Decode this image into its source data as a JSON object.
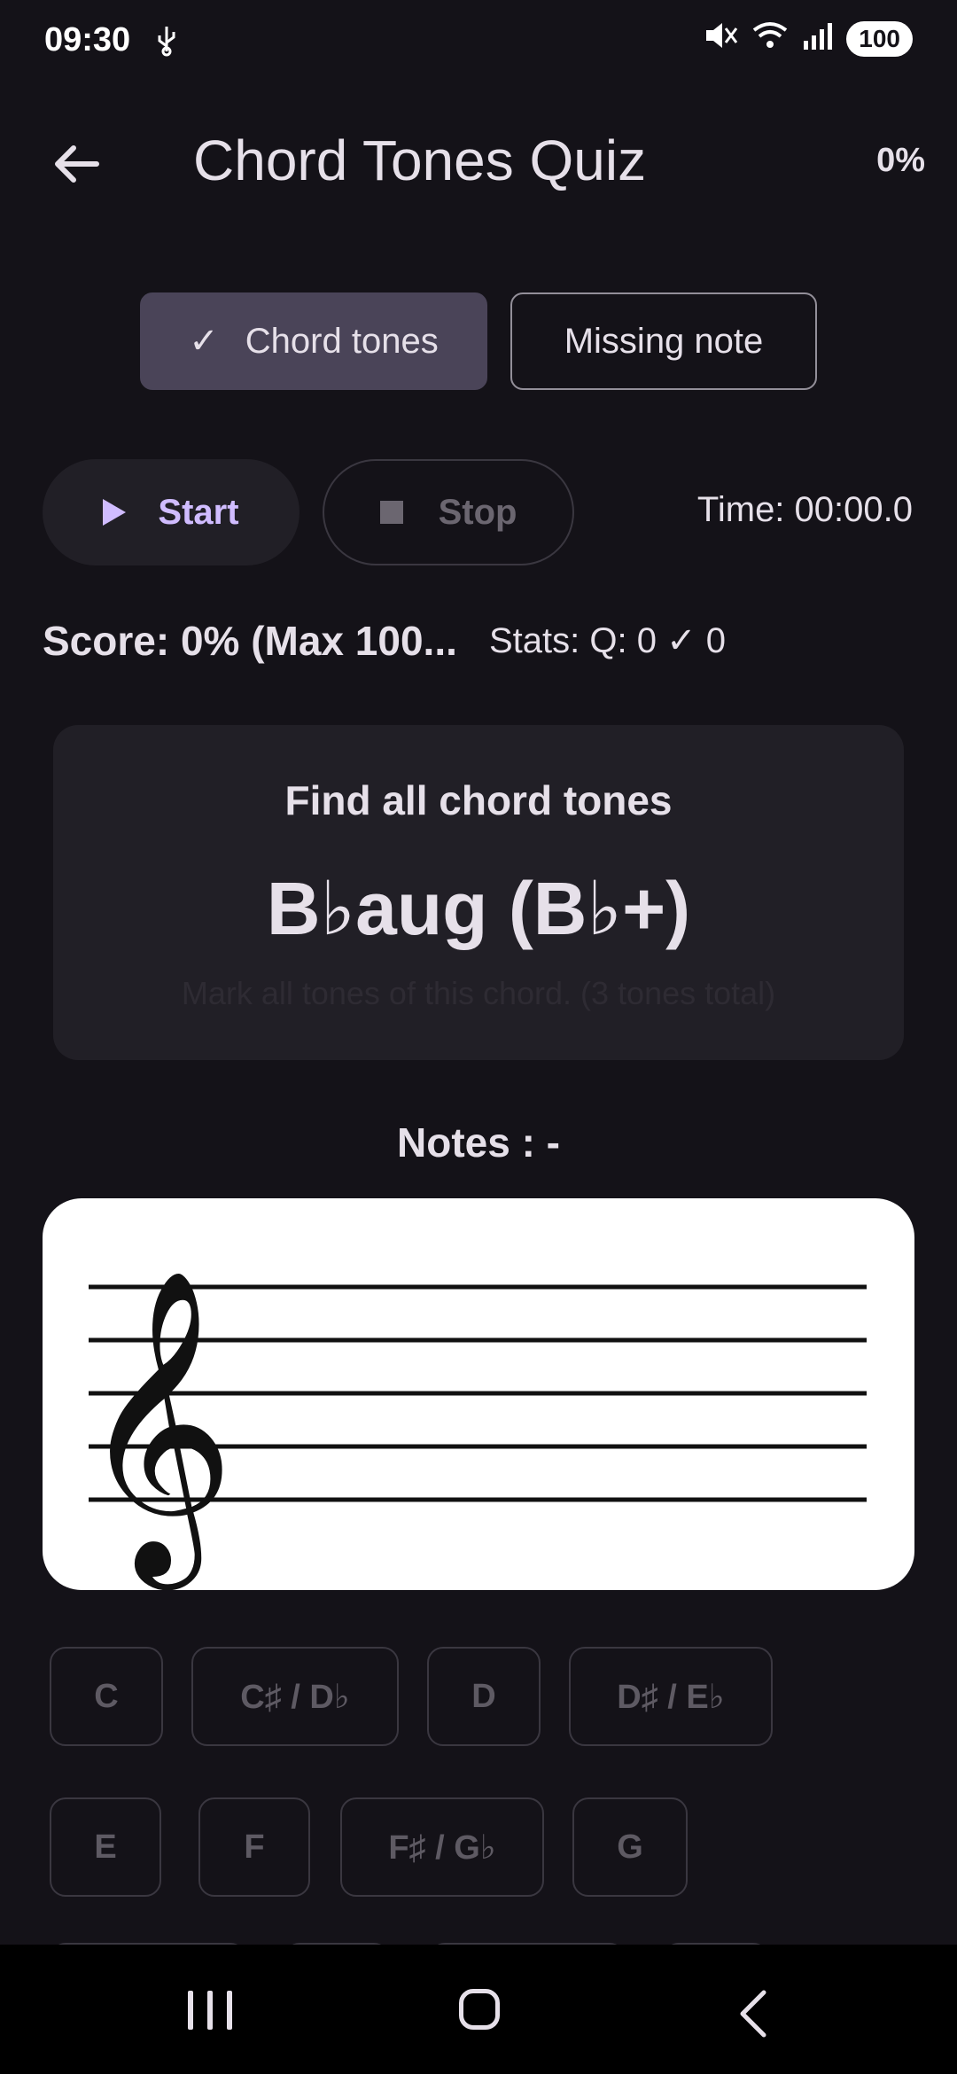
{
  "status_bar": {
    "time": "09:30",
    "battery": "100",
    "icons": [
      "usb-icon",
      "mute-icon",
      "wifi-icon",
      "signal-icon",
      "battery-icon"
    ]
  },
  "app_bar": {
    "title": "Chord Tones Quiz",
    "progress": "0%"
  },
  "modes": {
    "chord_tones": "Chord tones",
    "missing_note": "Missing note",
    "selected": "chord_tones"
  },
  "controls": {
    "start": "Start",
    "stop": "Stop",
    "time": "Time: 00:00.0"
  },
  "score": {
    "score_text": "Score: 0% (Max 100...",
    "stats_text": "Stats: Q: 0  ✓ 0"
  },
  "question": {
    "title": "Find all chord tones",
    "chord": "B♭aug (B♭+)",
    "hint": "Mark all tones of this chord. (3 tones total)"
  },
  "notes": {
    "label": "Notes : -"
  },
  "keys": {
    "row1": [
      "C",
      "C♯ / D♭",
      "D",
      "D♯ / E♭"
    ],
    "row2": [
      "E",
      "F",
      "F♯ / G♭",
      "G"
    ]
  },
  "colors": {
    "background": "#141218",
    "accent": "#d0bcff",
    "selected_segment": "#4a4458",
    "card": "#211f26"
  }
}
